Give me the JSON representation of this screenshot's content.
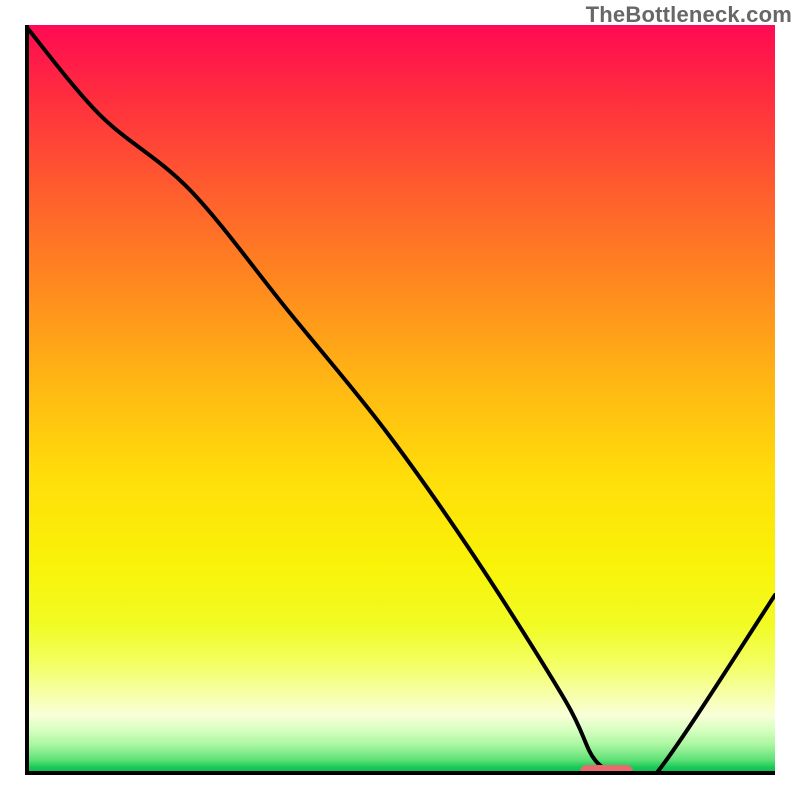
{
  "watermark": "TheBottleneck.com",
  "chart_data": {
    "type": "line",
    "title": "",
    "xlabel": "",
    "ylabel": "",
    "xlim": [
      0,
      100
    ],
    "ylim": [
      0,
      100
    ],
    "grid": false,
    "legend": false,
    "series": [
      {
        "name": "curve",
        "x": [
          0,
          10,
          22,
          35,
          48,
          60,
          72,
          76,
          80,
          84,
          100
        ],
        "y": [
          100,
          88,
          78,
          62,
          46,
          29,
          10,
          2,
          0,
          0,
          24
        ]
      }
    ],
    "marker": {
      "x_start": 74,
      "x_end": 81,
      "y": 0
    },
    "background_gradient": {
      "stops": [
        {
          "pos": 0,
          "color": "#ff0a52"
        },
        {
          "pos": 10,
          "color": "#ff2f3e"
        },
        {
          "pos": 22,
          "color": "#ff5d2e"
        },
        {
          "pos": 35,
          "color": "#ff8a1e"
        },
        {
          "pos": 48,
          "color": "#ffb813"
        },
        {
          "pos": 60,
          "color": "#ffdd0a"
        },
        {
          "pos": 72,
          "color": "#f9f308"
        },
        {
          "pos": 80,
          "color": "#f1fb24"
        },
        {
          "pos": 85,
          "color": "#f3ff60"
        },
        {
          "pos": 89,
          "color": "#f6ffa4"
        },
        {
          "pos": 92,
          "color": "#f9ffd8"
        },
        {
          "pos": 94,
          "color": "#d7ffc0"
        },
        {
          "pos": 96,
          "color": "#a9f6a0"
        },
        {
          "pos": 98,
          "color": "#5fe077"
        },
        {
          "pos": 99,
          "color": "#18c957"
        },
        {
          "pos": 100,
          "color": "#05b84d"
        }
      ]
    }
  }
}
